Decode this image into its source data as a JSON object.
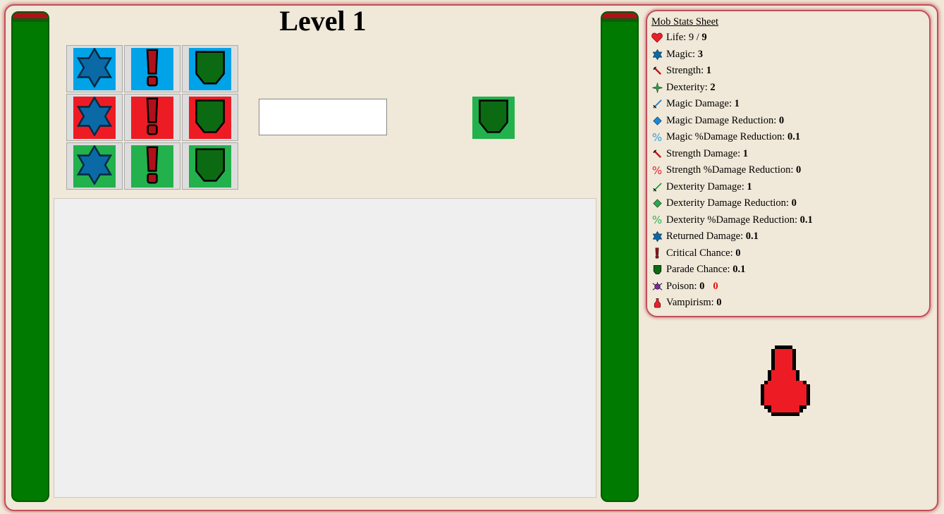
{
  "level_title": "Level 1",
  "grid": {
    "rows": [
      {
        "color": "#00a2e8",
        "cells": [
          "star-icon",
          "exclamation-icon",
          "shield-icon"
        ]
      },
      {
        "color": "#ed1c24",
        "cells": [
          "star-icon",
          "exclamation-icon",
          "shield-icon"
        ]
      },
      {
        "color": "#22b14c",
        "cells": [
          "star-icon",
          "exclamation-icon",
          "shield-icon"
        ]
      }
    ]
  },
  "answer_input": {
    "value": "",
    "placeholder": ""
  },
  "preview": {
    "icon": "shield-icon",
    "color": "#22b14c"
  },
  "stats": {
    "heading": "Mob Stats Sheet",
    "life": {
      "label": "Life:",
      "current": "9",
      "sep": "/",
      "max": "9"
    },
    "rows": [
      {
        "icon": "star-icon",
        "label": "Magic:",
        "value": "3"
      },
      {
        "icon": "sword-red-icon",
        "label": "Strength:",
        "value": "1"
      },
      {
        "icon": "sparkle-green-icon",
        "label": "Dexterity:",
        "value": "2"
      },
      {
        "icon": "sword-blue-icon",
        "label": "Magic Damage:",
        "value": "1"
      },
      {
        "icon": "diamond-blue-icon",
        "label": "Magic Damage Reduction:",
        "value": "0"
      },
      {
        "icon": "percent-blue-icon",
        "label": "Magic %Damage Reduction:",
        "value": "0.1"
      },
      {
        "icon": "sword-red-icon",
        "label": "Strength Damage:",
        "value": "1"
      },
      {
        "icon": "percent-red-icon",
        "label": "Strength %Damage Reduction:",
        "value": "0"
      },
      {
        "icon": "sword-green-icon",
        "label": "Dexterity Damage:",
        "value": "1"
      },
      {
        "icon": "diamond-green-icon",
        "label": "Dexterity Damage Reduction:",
        "value": "0"
      },
      {
        "icon": "percent-green-icon",
        "label": "Dexterity %Damage Reduction:",
        "value": "0.1"
      },
      {
        "icon": "star-icon",
        "label": "Returned Damage:",
        "value": "0.1"
      },
      {
        "icon": "exclamation-icon",
        "label": "Critical Chance:",
        "value": "0"
      },
      {
        "icon": "shield-icon",
        "label": "Parade Chance:",
        "value": "0.1"
      },
      {
        "icon": "poison-icon",
        "label": "Poison:",
        "value": "0",
        "extra": "0"
      },
      {
        "icon": "potion-icon",
        "label": "Vampirism:",
        "value": "0"
      }
    ]
  },
  "colors": {
    "accent_frame": "#c0505a",
    "bar_green": "#007a00",
    "bar_red": "#b0101a",
    "potion_red": "#ed1c24"
  }
}
